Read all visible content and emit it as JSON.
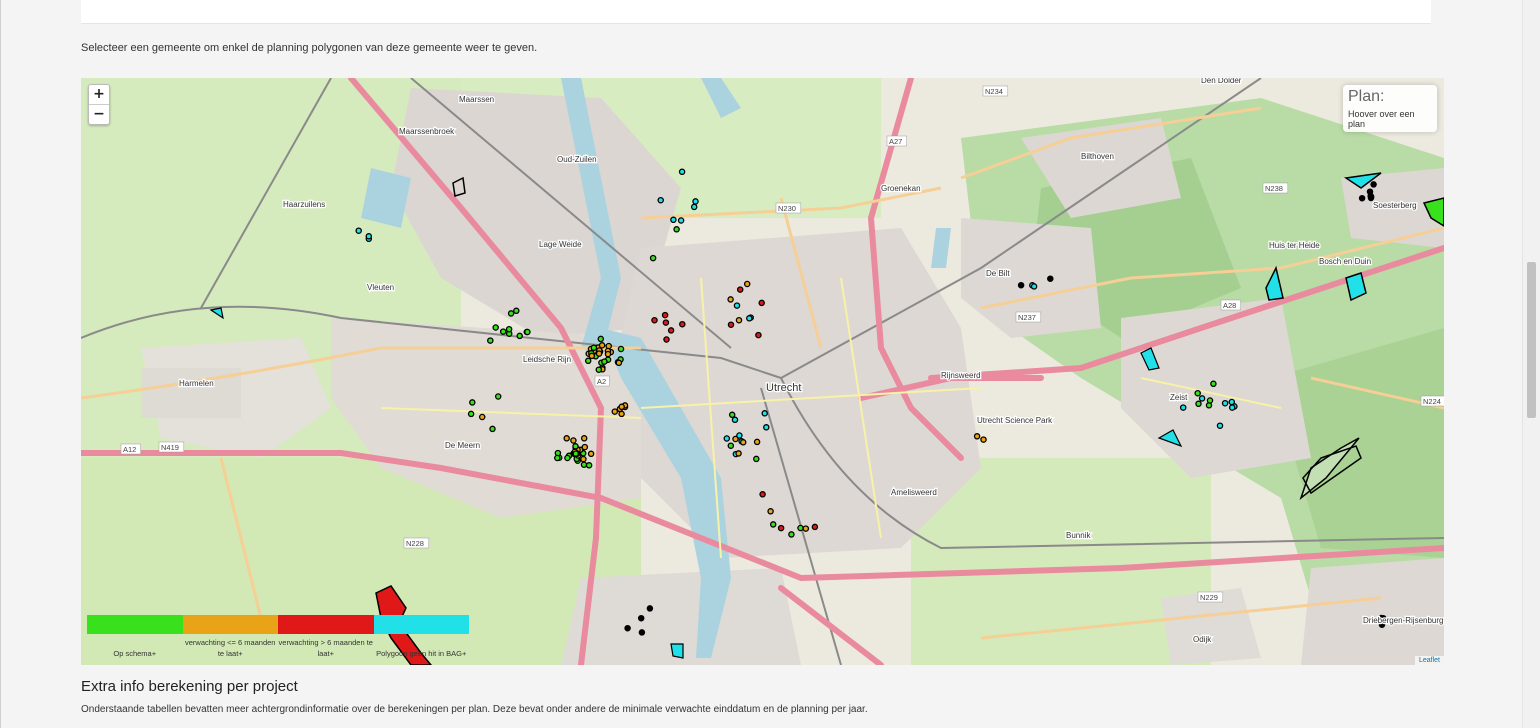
{
  "top_panel": {},
  "intro_text": "Selecteer een gemeente om enkel de planning polygonen van deze gemeente weer te geven.",
  "map": {
    "zoom_in": "+",
    "zoom_out": "−",
    "info_title": "Plan:",
    "info_subtitle": "Hoover over een plan",
    "attribution": "Leaflet",
    "place_labels": [
      "Maarssen",
      "Maarssenbroek",
      "Oud-Zuilen",
      "Haarzuilens",
      "Vleuten",
      "Harmelen",
      "De Meern",
      "Leidsche Rijn",
      "Utrecht",
      "De Bilt",
      "Bilthoven",
      "Zeist",
      "Huis ter Heide",
      "Bosch en Duin",
      "Soesterberg",
      "Bunnik",
      "Odijk",
      "Driebergen-Rijsenburg",
      "Den Dolder",
      "Groenekan",
      "Lage Weide",
      "Utrecht Science Park",
      "Amelisweerd",
      "Rijnsweerd"
    ],
    "road_labels": [
      "A2",
      "A12",
      "A27",
      "A28",
      "N230",
      "N234",
      "N237",
      "N238",
      "N224",
      "N229",
      "N228",
      "N419"
    ],
    "colors": {
      "green": "#39e01c",
      "orange": "#e8a317",
      "red": "#e01818",
      "cyan": "#22e0e8",
      "highway": "#e4889a",
      "primary": "#f2c98a",
      "rail": "#7a7a7a",
      "water": "#aad3df",
      "urban": "#e0dcd8",
      "forest": "#add19e",
      "grass": "#cde8b0",
      "land": "#eceadf"
    }
  },
  "legend": [
    {
      "color": "#39e01c",
      "label": "Op schema+"
    },
    {
      "color": "#e8a317",
      "label": "verwachting <= 6 maanden te laat+"
    },
    {
      "color": "#e01818",
      "label": "verwachting > 6 maanden te laat+"
    },
    {
      "color": "#22e0e8",
      "label": "Polygoon geen hit in BAG+"
    }
  ],
  "section": {
    "title": "Extra info berekening per project",
    "text": "Onderstaande tabellen bevatten meer achtergrondinformatie over de berekeningen per plan. Deze bevat onder andere de minimale verwachte einddatum en de planning per jaar."
  }
}
